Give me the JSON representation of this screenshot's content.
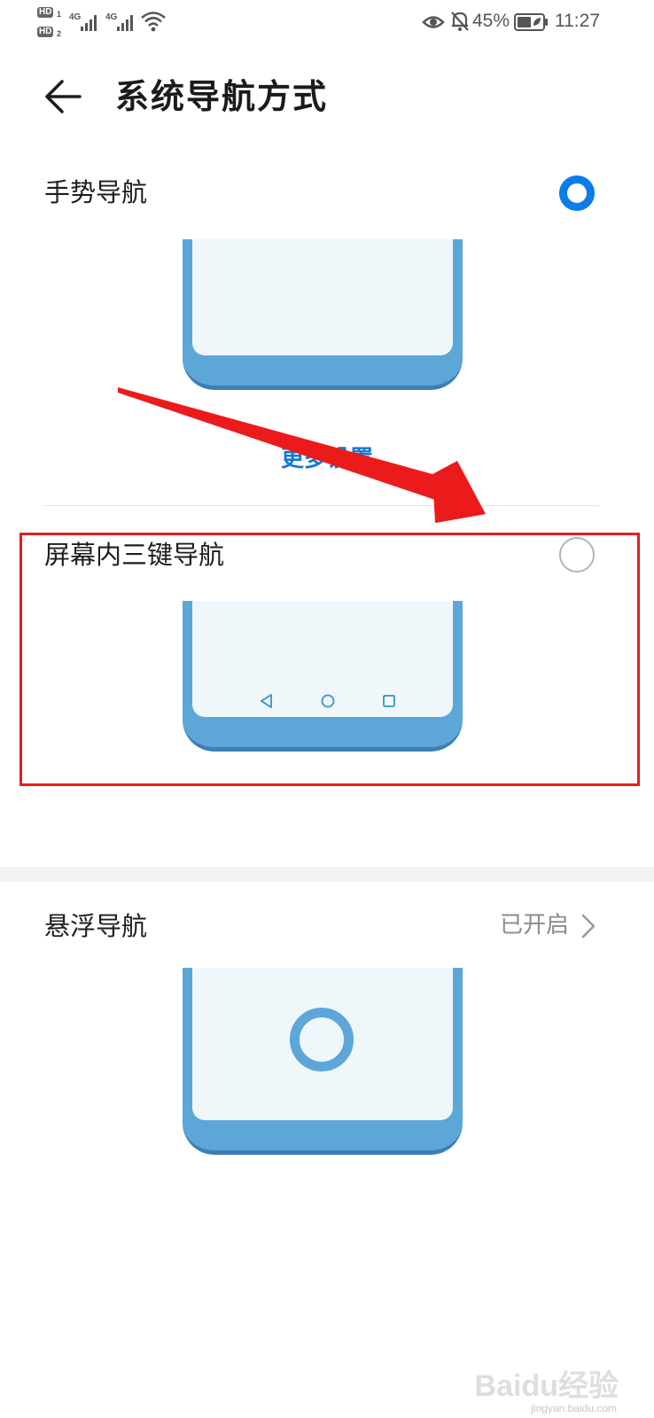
{
  "status_bar": {
    "hd1": "HD",
    "hd1_num": "1",
    "hd2": "HD",
    "hd2_num": "2",
    "net1": "4G",
    "net2": "4G",
    "battery": "45%",
    "time": "11:27",
    "icons": [
      "eye-icon",
      "bell-off-icon",
      "battery-icon",
      "wifi-icon",
      "signal-icon"
    ]
  },
  "header": {
    "title": "系统导航方式",
    "back_icon": "back-arrow-icon"
  },
  "options": [
    {
      "label": "手势导航",
      "selected": true,
      "more_settings": "更多设置"
    },
    {
      "label": "屏幕内三键导航",
      "selected": false,
      "nav_icons": [
        "triangle-back-icon",
        "circle-home-icon",
        "square-recent-icon"
      ]
    },
    {
      "label": "悬浮导航",
      "status": "已开启"
    }
  ],
  "watermark": {
    "text": "Baidu经验",
    "sub": "jingyan.baidu.com"
  },
  "colors": {
    "accent": "#0a7de8",
    "link": "#1478d4",
    "phone_frame": "#5da6d8",
    "phone_screen": "#eff7fb",
    "annotation_red": "#e61e1e"
  }
}
